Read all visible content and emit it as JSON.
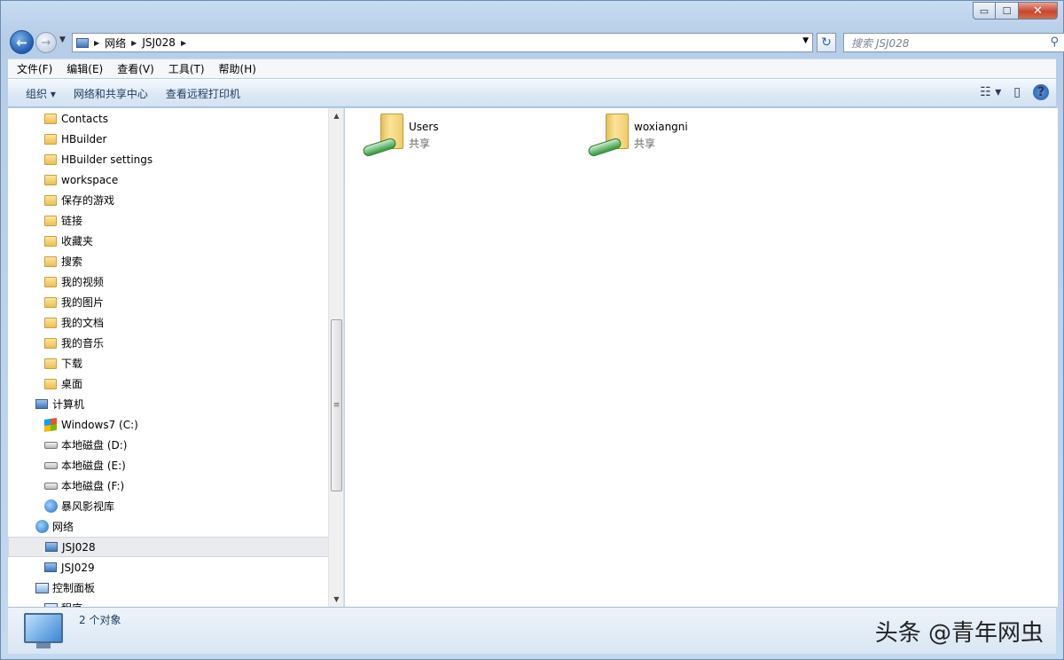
{
  "window": {
    "controls": {
      "minimize": "▭",
      "maximize": "☐",
      "close": "✕"
    }
  },
  "nav": {
    "back_icon": "arrow-left-icon",
    "forward_icon": "arrow-right-icon",
    "breadcrumb": [
      "网络",
      "JSJ028"
    ],
    "search_placeholder": "搜索 JSJ028"
  },
  "menubar": {
    "items": [
      "文件(F)",
      "编辑(E)",
      "查看(V)",
      "工具(T)",
      "帮助(H)"
    ]
  },
  "toolbar": {
    "organize": "组织 ▾",
    "network_center": "网络和共享中心",
    "remote_printers": "查看远程打印机"
  },
  "tree": {
    "items": [
      {
        "label": "Contacts",
        "icon": "contacts-folder-icon"
      },
      {
        "label": "HBuilder",
        "icon": "folder-icon"
      },
      {
        "label": "HBuilder settings",
        "icon": "folder-icon"
      },
      {
        "label": "workspace",
        "icon": "folder-icon"
      },
      {
        "label": "保存的游戏",
        "icon": "saved-games-icon"
      },
      {
        "label": "链接",
        "icon": "links-icon"
      },
      {
        "label": "收藏夹",
        "icon": "favorites-icon"
      },
      {
        "label": "搜索",
        "icon": "searches-icon"
      },
      {
        "label": "我的视频",
        "icon": "videos-icon"
      },
      {
        "label": "我的图片",
        "icon": "pictures-icon"
      },
      {
        "label": "我的文档",
        "icon": "documents-icon"
      },
      {
        "label": "我的音乐",
        "icon": "music-icon"
      },
      {
        "label": "下载",
        "icon": "downloads-icon"
      },
      {
        "label": "桌面",
        "icon": "desktop-icon"
      },
      {
        "label": "计算机",
        "icon": "computer-icon"
      },
      {
        "label": "Windows7 (C:)",
        "icon": "windows-drive-icon"
      },
      {
        "label": "本地磁盘 (D:)",
        "icon": "drive-icon"
      },
      {
        "label": "本地磁盘 (E:)",
        "icon": "drive-icon"
      },
      {
        "label": "本地磁盘 (F:)",
        "icon": "drive-icon"
      },
      {
        "label": "暴风影视库",
        "icon": "media-library-icon"
      },
      {
        "label": "网络",
        "icon": "network-icon"
      },
      {
        "label": "JSJ028",
        "icon": "network-computer-icon"
      },
      {
        "label": "JSJ029",
        "icon": "network-computer-icon"
      },
      {
        "label": "控制面板",
        "icon": "control-panel-icon"
      },
      {
        "label": "程序",
        "icon": "programs-icon"
      }
    ]
  },
  "content": {
    "items": [
      {
        "name": "Users",
        "sub": "共享"
      },
      {
        "name": "woxiangni",
        "sub": "共享"
      }
    ]
  },
  "status": {
    "count": "2 个对象",
    "watermark": "头条 @青年网虫"
  }
}
